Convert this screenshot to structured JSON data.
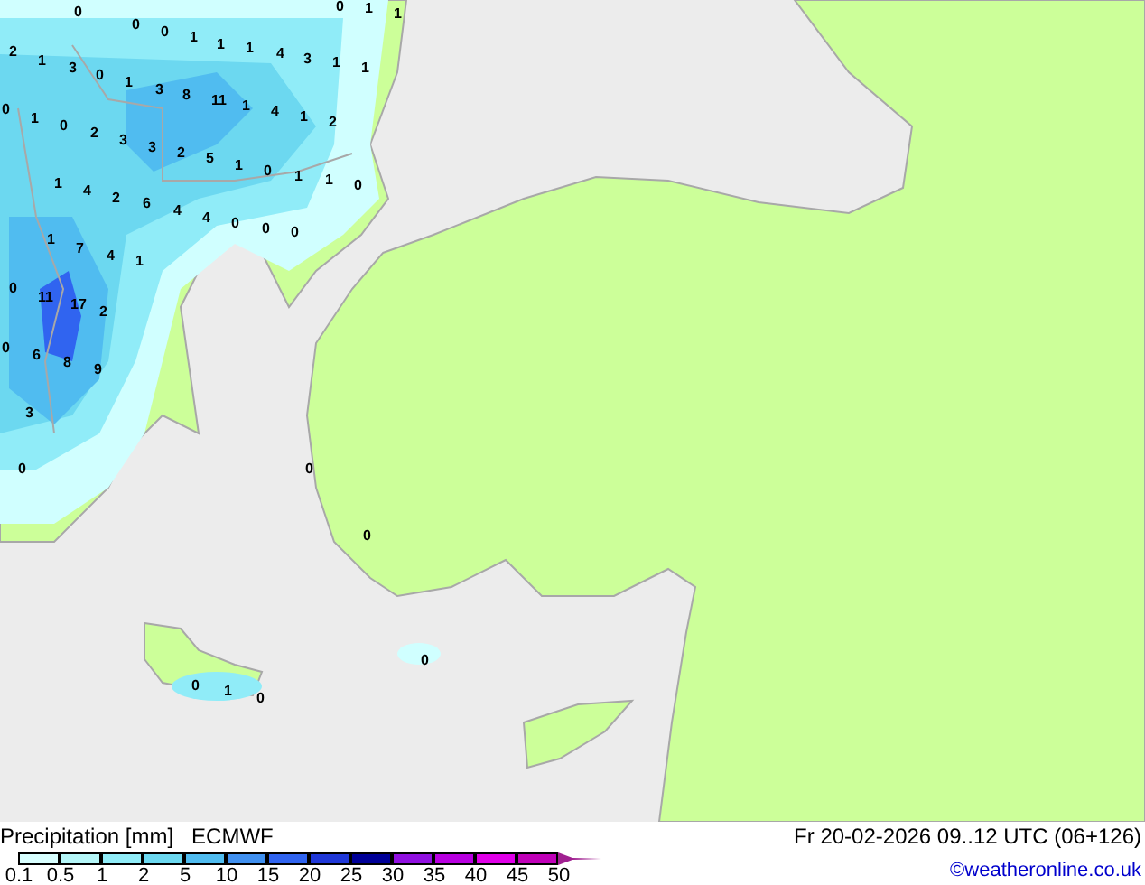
{
  "map_labels": [
    "0",
    "0",
    "1",
    "1",
    "0",
    "0",
    "1",
    "1",
    "2",
    "1",
    "4",
    "1",
    "3",
    "3",
    "1",
    "1",
    "0",
    "1",
    "3",
    "8",
    "0",
    "11",
    "1",
    "1",
    "4",
    "1",
    "0",
    "2",
    "2",
    "3",
    "3",
    "2",
    "5",
    "1",
    "0",
    "1",
    "1",
    "1",
    "0",
    "4",
    "2",
    "6",
    "4",
    "4",
    "0",
    "0",
    "0",
    "1",
    "7",
    "4",
    "1",
    "0",
    "11",
    "17",
    "2",
    "0",
    "6",
    "8",
    "9",
    "3",
    "0",
    "0",
    "0",
    "0",
    "0",
    "1",
    "0"
  ],
  "legend": {
    "title": "Precipitation [mm]",
    "model": "ECMWF",
    "swatches": [
      {
        "color": "#d8ffff"
      },
      {
        "color": "#b4f6f8"
      },
      {
        "color": "#90ecf8"
      },
      {
        "color": "#6cd8f0"
      },
      {
        "color": "#50bcf0"
      },
      {
        "color": "#4090f0"
      },
      {
        "color": "#3064f0"
      },
      {
        "color": "#2038d8"
      },
      {
        "color": "#000098"
      },
      {
        "color": "#9010e0"
      },
      {
        "color": "#b800e0"
      },
      {
        "color": "#e000e8"
      },
      {
        "color": "#c000b8"
      }
    ],
    "ticks": [
      "0.1",
      "0.5",
      "1",
      "2",
      "5",
      "10",
      "15",
      "20",
      "25",
      "30",
      "35",
      "40",
      "45",
      "50"
    ]
  },
  "valid_time": "Fr 20-02-2026 09..12 UTC (06+126)",
  "credit": "©weatheronline.co.uk"
}
